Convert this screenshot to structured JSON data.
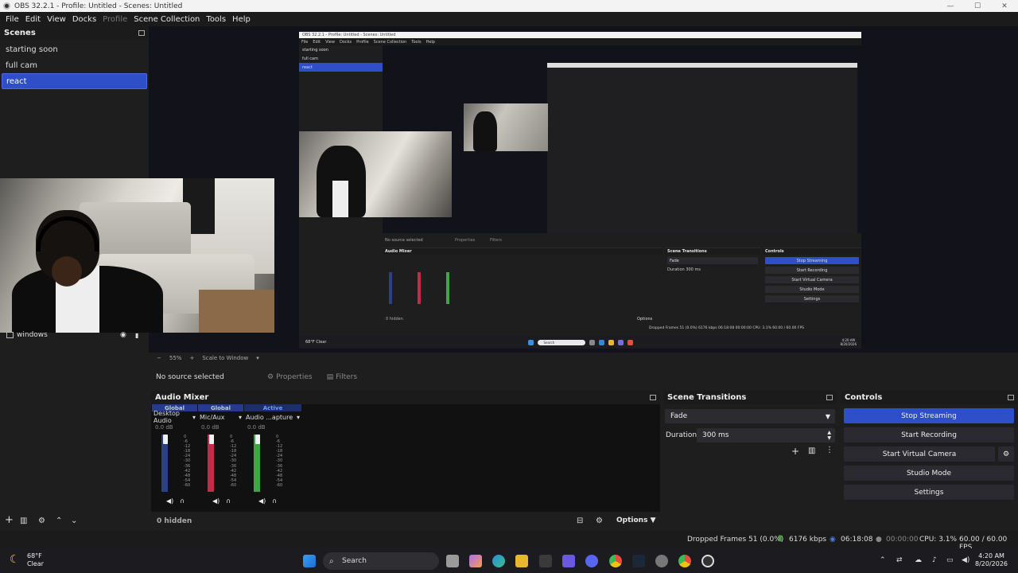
{
  "window": {
    "title": "OBS 32.2.1 - Profile: Untitled - Scenes: Untitled",
    "min": "—",
    "max": "☐",
    "close": "✕"
  },
  "menu": [
    "File",
    "Edit",
    "View",
    "Docks",
    "Profile",
    "Scene Collection",
    "Tools",
    "Help"
  ],
  "scenes": {
    "header": "Scenes",
    "items": [
      "starting soon",
      "full cam",
      "react"
    ],
    "selected": "react"
  },
  "nested": {
    "title": "OBS 32.2.1 - Profile: Untitled - Scenes: Untitled",
    "menu": [
      "File",
      "Edit",
      "View",
      "Docks",
      "Profile",
      "Scene Collection",
      "Tools",
      "Help"
    ],
    "scenes": [
      "starting soon",
      "full cam",
      "react"
    ],
    "source": "windows",
    "no_source": "No source selected",
    "properties": "Properties",
    "filters": "Filters",
    "zoom": "55%",
    "scale": "Scale to Window",
    "mixer": "Audio Mixer",
    "transitions": "Scene Transitions",
    "fade": "Fade",
    "duration_label": "Duration",
    "duration": "300 ms",
    "controls": "Controls",
    "buttons": [
      "Stop Streaming",
      "Start Recording",
      "Start Virtual Camera",
      "Studio Mode",
      "Settings"
    ],
    "hidden": "0 hidden",
    "options": "Options",
    "status": "Dropped Frames 51 (0.0%)   6176 kbps   06:18:08   00:00:00   CPU: 3.1%   60.00 / 60.00 FPS",
    "weather_temp": "68°F",
    "weather_desc": "Clear",
    "search": "Search",
    "time": "4:20 AM",
    "date": "8/20/2026"
  },
  "preview_bar": {
    "zoom": "55%",
    "scale": "Scale to Window"
  },
  "source": {
    "name": "windows"
  },
  "source_bar": {
    "no_source": "No source selected",
    "properties": "Properties",
    "filters": "Filters"
  },
  "mixer": {
    "header": "Audio Mixer",
    "channels": [
      {
        "tag": "Global",
        "name": "Desktop Audio",
        "db": "0.0 dB",
        "meter_color": "#2c3f8a"
      },
      {
        "tag": "Global",
        "name": "Mic/Aux",
        "db": "0.0 dB",
        "meter_color": "#c62a48"
      },
      {
        "tag": "Active",
        "name": "Audio ...apture",
        "db": "0.0 dB",
        "meter_color": "#3aa843"
      }
    ],
    "ticks": [
      "0",
      "-6",
      "-12",
      "-18",
      "-24",
      "-30",
      "-36",
      "-42",
      "-48",
      "-54",
      "-60"
    ]
  },
  "transitions": {
    "header": "Scene Transitions",
    "selected": "Fade",
    "duration_label": "Duration",
    "duration": "300 ms"
  },
  "controls": {
    "header": "Controls",
    "stop_streaming": "Stop Streaming",
    "start_recording": "Start Recording",
    "start_virtual_camera": "Start Virtual Camera",
    "studio_mode": "Studio Mode",
    "settings": "Settings"
  },
  "bottom": {
    "hidden": "0 hidden",
    "options": "Options"
  },
  "status": {
    "dropped": "Dropped Frames 51 (0.0%)",
    "kbps": "6176 kbps",
    "stream_time": "06:18:08",
    "rec_time": "00:00:00",
    "cpu": "CPU: 3.1%",
    "fps": "60.00 / 60.00 FPS"
  },
  "taskbar": {
    "weather_temp": "68°F",
    "weather_desc": "Clear",
    "search": "Search",
    "time": "4:20 AM",
    "date": "8/20/2026"
  },
  "colors": {
    "accent": "#2e4fc8",
    "panel": "#1e1e1e",
    "preview_bg": "#12131a"
  }
}
